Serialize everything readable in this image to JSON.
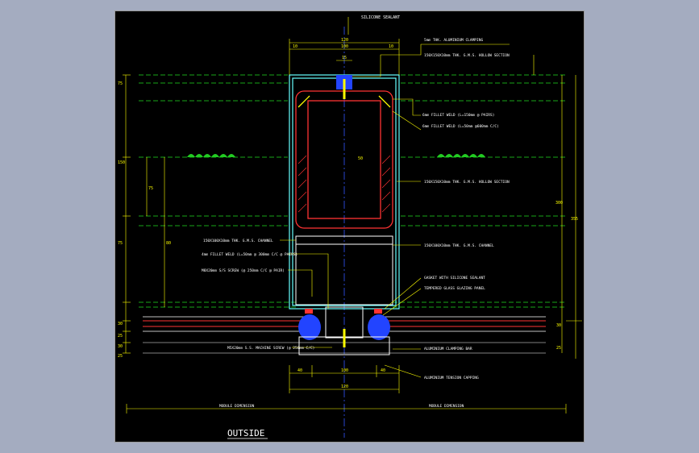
{
  "app": {
    "background_color": "#a4acc0",
    "canvas_color": "#000000"
  },
  "drawing": {
    "title": "OUTSIDE",
    "callouts": {
      "top_sealant": "SILICONE SEALANT",
      "clamping": "5mm THK. ALUMINIUM CLAMPING",
      "hollow_section_top": "150X150X10mm THK. G.M.S. HOLLOW SECTION",
      "fillet_weld_1": "6mm FILLET WELD (L=150mm @ PAIRS)",
      "fillet_weld_2": "6mm FILLET WELD (L=50mm @600mm C/C)",
      "hollow_section_mid": "150X150X10mm THK. G.M.S. HOLLOW SECTION",
      "channel_right": "150X100X10mm THK. G.M.S. CHANNEL",
      "gasket": "GASKET WITH SILICONE SEALANT",
      "glazing_panel": "TEMPERED GLASS GLAZING PANEL",
      "clamping_bar": "ALUMINIUM CLAMPING BAR",
      "tension_capping": "ALUMINIUM TENSION CAPPING",
      "channel_left": "150X100X10mm THK. G.M.S. CHANNEL",
      "weld_left": "4mm FILLET WELD (L=50mm @ 300mm C/C @ PAIRS)",
      "screw_left": "M8X20mm S/S SCREW (@ 250mm C/C @ PAIR)",
      "machine_screw": "M5X20mm S.S. MACHINE SCREW (@ 250mm C/C)",
      "dim_left": "MODULE DIMENSION",
      "dim_right": "MODULE DIMENSION"
    },
    "dimensions": {
      "top_total": "120",
      "top_left": "10",
      "top_right": "10",
      "top_inner": "100",
      "top_gap": "15",
      "left_1": "75",
      "left_2": "150",
      "left_3": "75",
      "left_4": "30",
      "left_5": "25",
      "left_6": "30",
      "left_7": "25",
      "inner_left_1": "75",
      "inner_left_2": "80",
      "center": "50",
      "right_1": "300",
      "right_2": "355",
      "right_3": "30",
      "right_4": "25",
      "bottom_l": "40",
      "bottom_m": "100",
      "bottom_r": "40",
      "bottom_total": "120"
    },
    "colors": {
      "frame": "#ffffff",
      "dimension": "#ffff00",
      "steel": "#ff3333",
      "hidden_line": "#22dd22",
      "aluminium": "#66ffff",
      "center_line": "#3355ff",
      "gasket": "#2244ff"
    }
  }
}
